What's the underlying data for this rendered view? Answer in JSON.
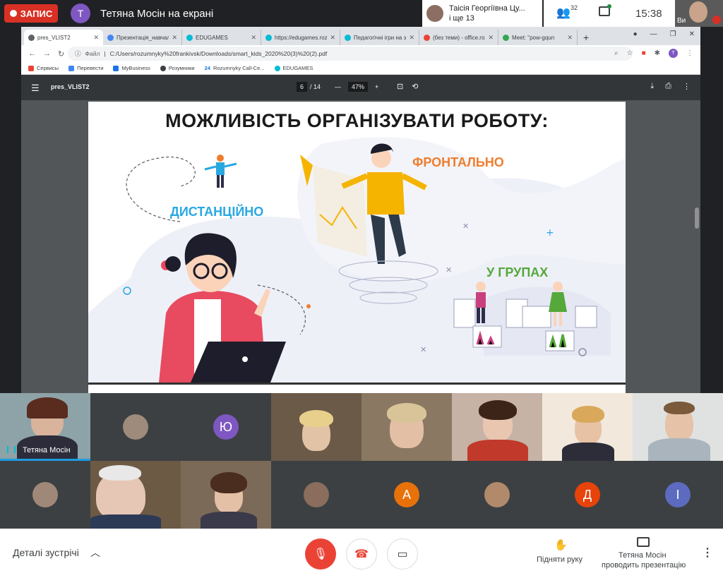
{
  "meet": {
    "recording_label": "ЗАПИС",
    "presenter_initial": "Т",
    "presenter_status": "Тетяна Мосін на екрані",
    "active_speaker_line1": "Таісія Георгіївна Цу...",
    "active_speaker_line2": "і ще 13",
    "participant_count": "32",
    "clock": "15:38",
    "self_label": "Ви"
  },
  "browser": {
    "tabs": [
      {
        "label": "pres_VLIST2",
        "color": "#5f6368"
      },
      {
        "label": "Презентація_навчаль",
        "color": "#4285f4"
      },
      {
        "label": "EDUGAMES",
        "color": "#00bcd4"
      },
      {
        "label": "https://edugames.roz",
        "color": "#00bcd4"
      },
      {
        "label": "Педагогічні ігри на з",
        "color": "#00bcd4"
      },
      {
        "label": "(без теми) - office.roz",
        "color": "#ea4335"
      },
      {
        "label": "Meet: \"pow-gqun",
        "color": "#34a853"
      }
    ],
    "address_prefix": "Файл",
    "address": "C:/Users/rozumnyky%20frankivsk/Downloads/smart_kids_2020%20(3)%20(2).pdf",
    "profile_initial": "T",
    "bookmarks": [
      {
        "label": "Сервисы",
        "color": "#ea4335"
      },
      {
        "label": "Перевести",
        "color": "#4285f4"
      },
      {
        "label": "MyBusiness",
        "color": "#1a73e8"
      },
      {
        "label": "Розумники",
        "color": "#3c4043"
      },
      {
        "label": "Rozumnyky Call-Ce...",
        "color": "#1a73e8"
      },
      {
        "label": "EDUGAMES",
        "color": "#00bcd4"
      }
    ],
    "bookmark_prefix": "24"
  },
  "pdf": {
    "filename": "pres_VLIST2",
    "page_current": "6",
    "page_total": "/ 14",
    "zoom": "47%"
  },
  "slide": {
    "title": "МОЖЛИВІСТЬ ОРГАНІЗУВАТИ РОБОТУ:",
    "label_distance": "ДИСТАНЦІЙНО",
    "label_frontal": "ФРОНТАЛЬНО",
    "label_groups": "У ГРУПАХ"
  },
  "participants": {
    "main_name": "Тетяна Мосін",
    "initials": [
      "Ю",
      "А",
      "Д",
      "І"
    ],
    "initial_colors": [
      "#7e57c2",
      "#e8710a",
      "#e8430a",
      "#5c6bc0"
    ]
  },
  "bottom": {
    "details_label": "Деталі зустрічі",
    "raise_hand_label": "Підняти руку",
    "presenting_line1": "Тетяна Мосін",
    "presenting_line2": "проводить презентацію"
  }
}
